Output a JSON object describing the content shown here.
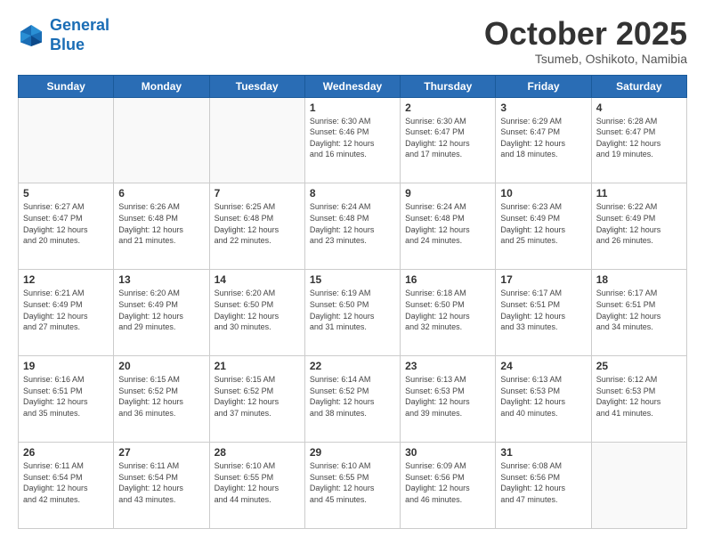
{
  "header": {
    "logo_line1": "General",
    "logo_line2": "Blue",
    "month": "October 2025",
    "location": "Tsumeb, Oshikoto, Namibia"
  },
  "weekdays": [
    "Sunday",
    "Monday",
    "Tuesday",
    "Wednesday",
    "Thursday",
    "Friday",
    "Saturday"
  ],
  "weeks": [
    [
      {
        "day": "",
        "info": ""
      },
      {
        "day": "",
        "info": ""
      },
      {
        "day": "",
        "info": ""
      },
      {
        "day": "1",
        "info": "Sunrise: 6:30 AM\nSunset: 6:46 PM\nDaylight: 12 hours\nand 16 minutes."
      },
      {
        "day": "2",
        "info": "Sunrise: 6:30 AM\nSunset: 6:47 PM\nDaylight: 12 hours\nand 17 minutes."
      },
      {
        "day": "3",
        "info": "Sunrise: 6:29 AM\nSunset: 6:47 PM\nDaylight: 12 hours\nand 18 minutes."
      },
      {
        "day": "4",
        "info": "Sunrise: 6:28 AM\nSunset: 6:47 PM\nDaylight: 12 hours\nand 19 minutes."
      }
    ],
    [
      {
        "day": "5",
        "info": "Sunrise: 6:27 AM\nSunset: 6:47 PM\nDaylight: 12 hours\nand 20 minutes."
      },
      {
        "day": "6",
        "info": "Sunrise: 6:26 AM\nSunset: 6:48 PM\nDaylight: 12 hours\nand 21 minutes."
      },
      {
        "day": "7",
        "info": "Sunrise: 6:25 AM\nSunset: 6:48 PM\nDaylight: 12 hours\nand 22 minutes."
      },
      {
        "day": "8",
        "info": "Sunrise: 6:24 AM\nSunset: 6:48 PM\nDaylight: 12 hours\nand 23 minutes."
      },
      {
        "day": "9",
        "info": "Sunrise: 6:24 AM\nSunset: 6:48 PM\nDaylight: 12 hours\nand 24 minutes."
      },
      {
        "day": "10",
        "info": "Sunrise: 6:23 AM\nSunset: 6:49 PM\nDaylight: 12 hours\nand 25 minutes."
      },
      {
        "day": "11",
        "info": "Sunrise: 6:22 AM\nSunset: 6:49 PM\nDaylight: 12 hours\nand 26 minutes."
      }
    ],
    [
      {
        "day": "12",
        "info": "Sunrise: 6:21 AM\nSunset: 6:49 PM\nDaylight: 12 hours\nand 27 minutes."
      },
      {
        "day": "13",
        "info": "Sunrise: 6:20 AM\nSunset: 6:49 PM\nDaylight: 12 hours\nand 29 minutes."
      },
      {
        "day": "14",
        "info": "Sunrise: 6:20 AM\nSunset: 6:50 PM\nDaylight: 12 hours\nand 30 minutes."
      },
      {
        "day": "15",
        "info": "Sunrise: 6:19 AM\nSunset: 6:50 PM\nDaylight: 12 hours\nand 31 minutes."
      },
      {
        "day": "16",
        "info": "Sunrise: 6:18 AM\nSunset: 6:50 PM\nDaylight: 12 hours\nand 32 minutes."
      },
      {
        "day": "17",
        "info": "Sunrise: 6:17 AM\nSunset: 6:51 PM\nDaylight: 12 hours\nand 33 minutes."
      },
      {
        "day": "18",
        "info": "Sunrise: 6:17 AM\nSunset: 6:51 PM\nDaylight: 12 hours\nand 34 minutes."
      }
    ],
    [
      {
        "day": "19",
        "info": "Sunrise: 6:16 AM\nSunset: 6:51 PM\nDaylight: 12 hours\nand 35 minutes."
      },
      {
        "day": "20",
        "info": "Sunrise: 6:15 AM\nSunset: 6:52 PM\nDaylight: 12 hours\nand 36 minutes."
      },
      {
        "day": "21",
        "info": "Sunrise: 6:15 AM\nSunset: 6:52 PM\nDaylight: 12 hours\nand 37 minutes."
      },
      {
        "day": "22",
        "info": "Sunrise: 6:14 AM\nSunset: 6:52 PM\nDaylight: 12 hours\nand 38 minutes."
      },
      {
        "day": "23",
        "info": "Sunrise: 6:13 AM\nSunset: 6:53 PM\nDaylight: 12 hours\nand 39 minutes."
      },
      {
        "day": "24",
        "info": "Sunrise: 6:13 AM\nSunset: 6:53 PM\nDaylight: 12 hours\nand 40 minutes."
      },
      {
        "day": "25",
        "info": "Sunrise: 6:12 AM\nSunset: 6:53 PM\nDaylight: 12 hours\nand 41 minutes."
      }
    ],
    [
      {
        "day": "26",
        "info": "Sunrise: 6:11 AM\nSunset: 6:54 PM\nDaylight: 12 hours\nand 42 minutes."
      },
      {
        "day": "27",
        "info": "Sunrise: 6:11 AM\nSunset: 6:54 PM\nDaylight: 12 hours\nand 43 minutes."
      },
      {
        "day": "28",
        "info": "Sunrise: 6:10 AM\nSunset: 6:55 PM\nDaylight: 12 hours\nand 44 minutes."
      },
      {
        "day": "29",
        "info": "Sunrise: 6:10 AM\nSunset: 6:55 PM\nDaylight: 12 hours\nand 45 minutes."
      },
      {
        "day": "30",
        "info": "Sunrise: 6:09 AM\nSunset: 6:56 PM\nDaylight: 12 hours\nand 46 minutes."
      },
      {
        "day": "31",
        "info": "Sunrise: 6:08 AM\nSunset: 6:56 PM\nDaylight: 12 hours\nand 47 minutes."
      },
      {
        "day": "",
        "info": ""
      }
    ]
  ]
}
